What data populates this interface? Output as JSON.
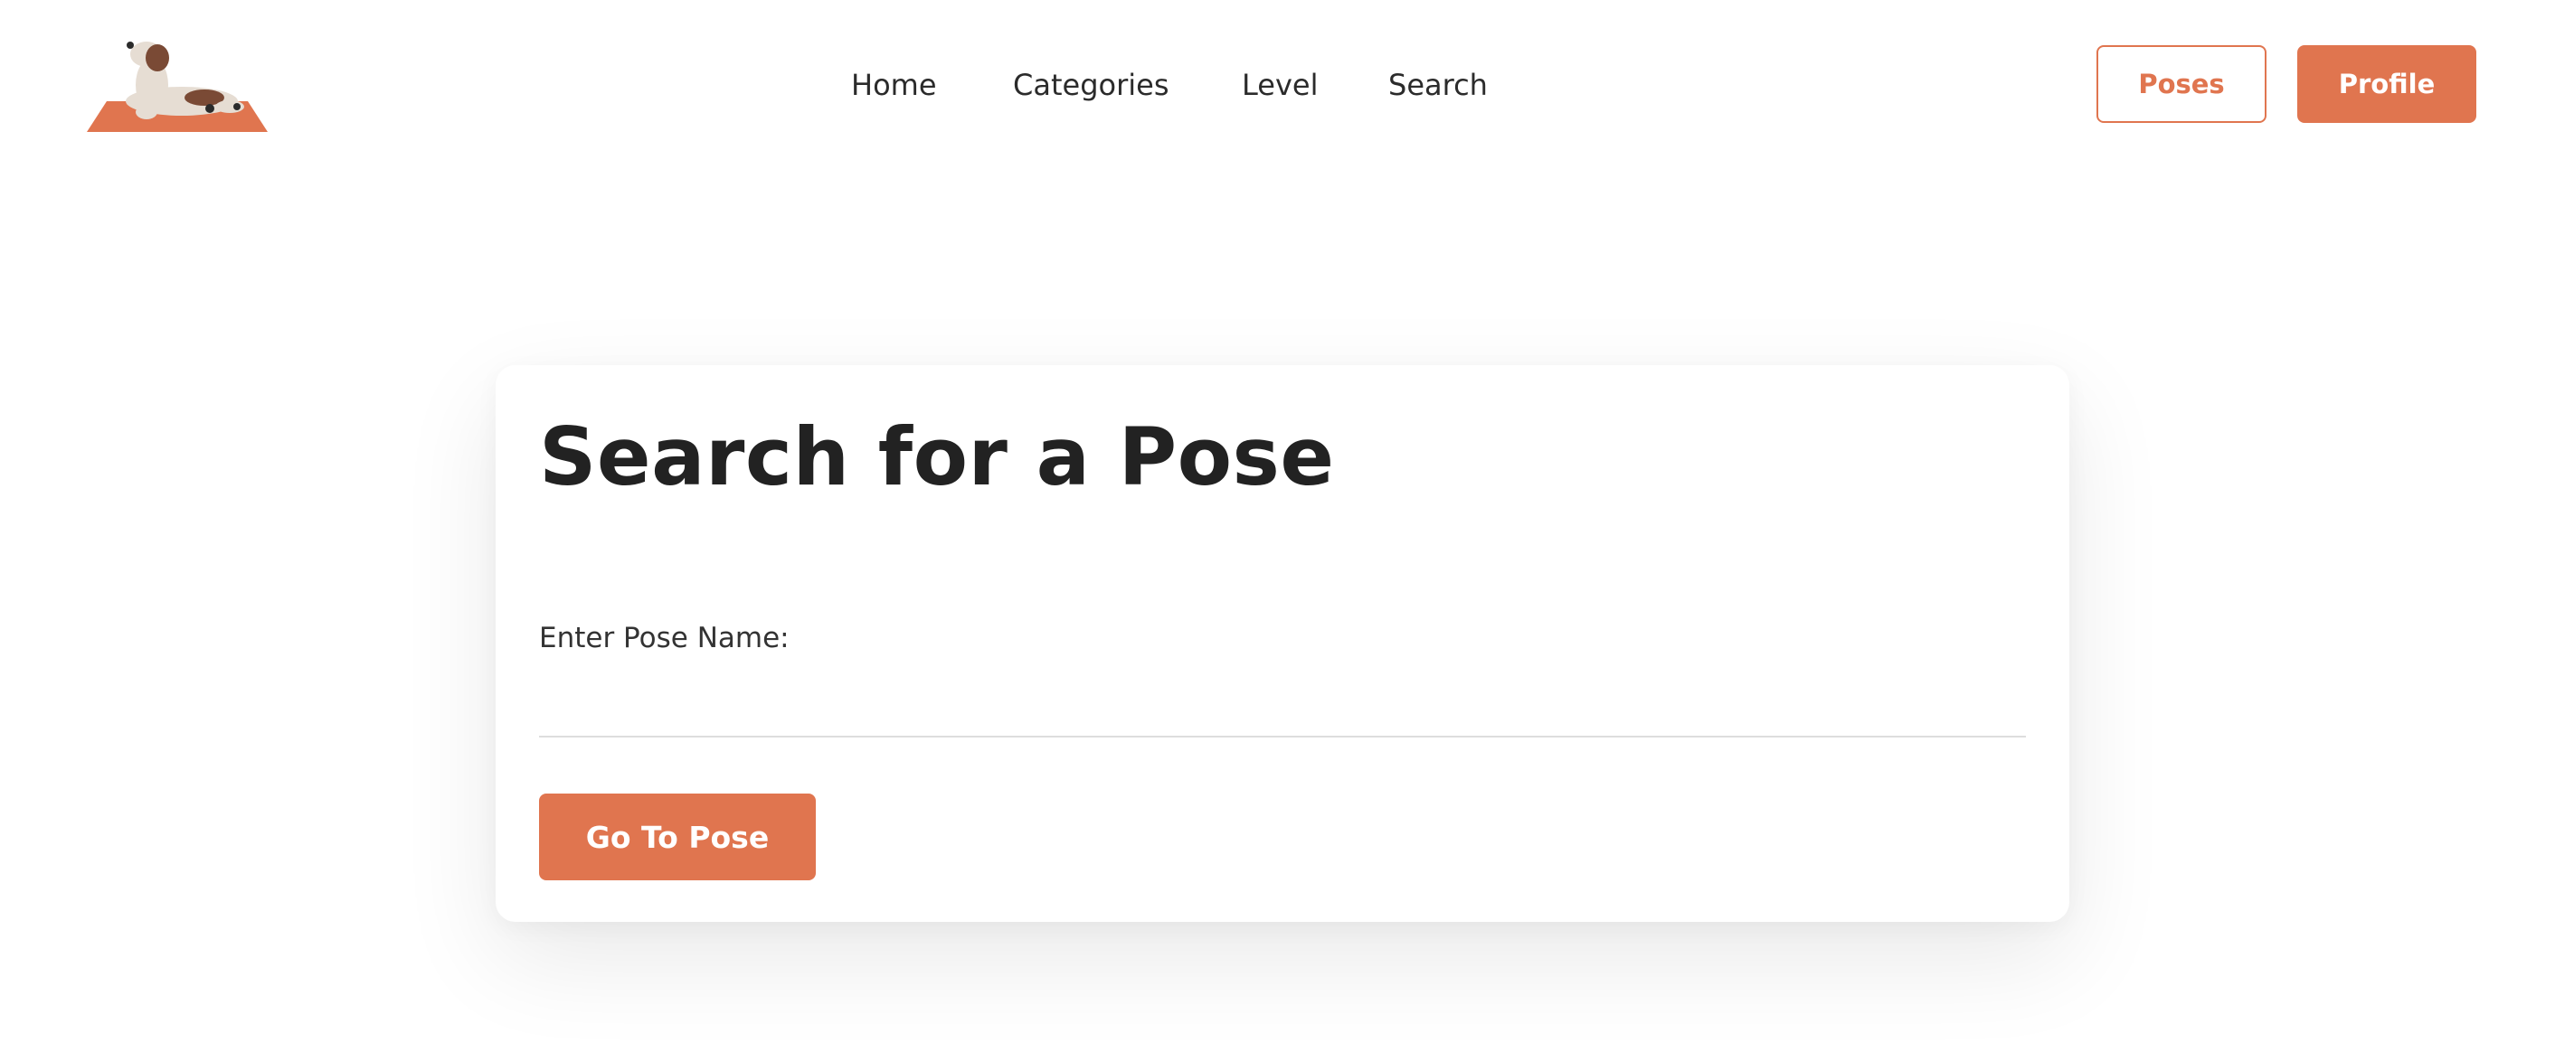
{
  "nav": {
    "links": [
      "Home",
      "Categories",
      "Level",
      "Search"
    ]
  },
  "header": {
    "logo_icon": "dog-yoga-mat-icon",
    "poses_button": "Poses",
    "profile_button": "Profile"
  },
  "search_card": {
    "title": "Search for a Pose",
    "field_label": "Enter Pose Name:",
    "field_value": "",
    "submit_label": "Go To Pose"
  },
  "colors": {
    "accent": "#e0754f",
    "text": "#222222",
    "background": "#ffffff"
  }
}
